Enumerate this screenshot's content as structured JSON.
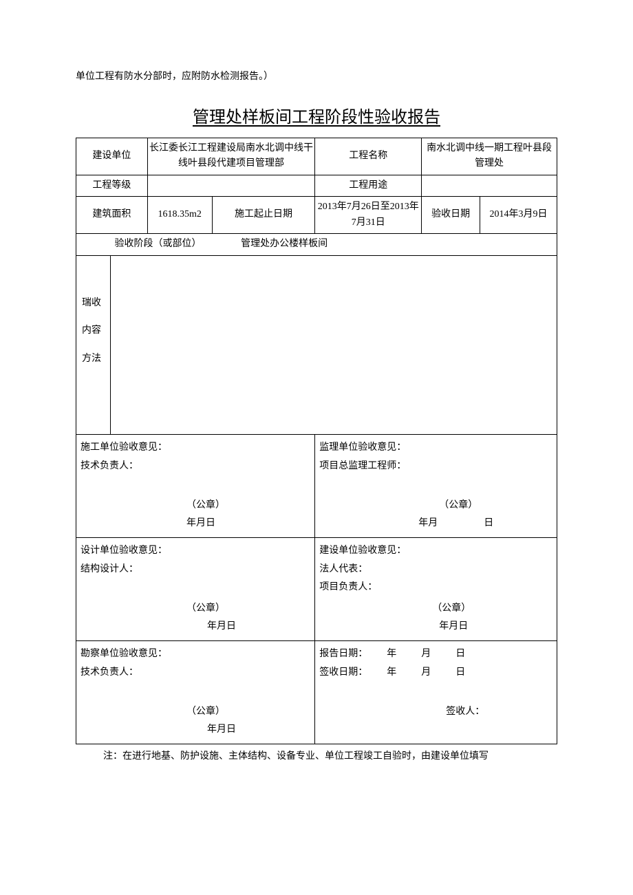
{
  "preamble": "单位工程有防水分部时，应附防水检测报告。）",
  "title": "管理处样板间工程阶段性验收报告",
  "header": {
    "row1": {
      "label1": "建设单位",
      "val1": "长江委长江工程建设局南水北调中线干线叶县段代建项目管理部",
      "label2": "工程名称",
      "val2": "南水北调中线一期工程叶县段管理处"
    },
    "row2": {
      "label1": "工程等级",
      "val1": "",
      "label2": "工程用途",
      "val2": ""
    },
    "row3": {
      "label1": "建筑面积",
      "val1": "1618.35m2",
      "label2": "施工起止日期",
      "val2": "2013年7月26日至2013年7月31日",
      "label3": "验收日期",
      "val3": "2014年3月9日"
    },
    "stage": {
      "label": "验收阶段（或部位）",
      "val": "管理处办公楼样板间"
    }
  },
  "content": {
    "line1": "瑞收",
    "line2": "内容",
    "line3": "方法"
  },
  "sig": {
    "construction": {
      "l1": "施工单位验收意见：",
      "l2": "技术负责人：",
      "seal": "（公章）",
      "date": "年月日"
    },
    "supervisor": {
      "l1": "监理单位验收意见：",
      "l2": "项目总监理工程师：",
      "seal": "（公章）",
      "date_ym": "年月",
      "date_d": "日"
    },
    "design": {
      "l1": "设计单位验收意见：",
      "l2": "结构设计人：",
      "seal": "（公章）",
      "date": "年月日"
    },
    "builder": {
      "l1": "建设单位验收意见：",
      "l2": "法人代表：",
      "l3": "项目负责人：",
      "seal": "（公章）",
      "date": "年月日"
    },
    "survey": {
      "l1": "勘察单位验收意见：",
      "l2": "技术负责人：",
      "seal": "（公章）",
      "date": "年月日"
    },
    "report": {
      "report_label": "报告日期：",
      "sign_label": "签收日期：",
      "y": "年",
      "m": "月",
      "d": "日",
      "recipient": "签收人："
    }
  },
  "note": "注：在进行地基、防护设施、主体结构、设备专业、单位工程竣工自验时，由建设单位填写"
}
